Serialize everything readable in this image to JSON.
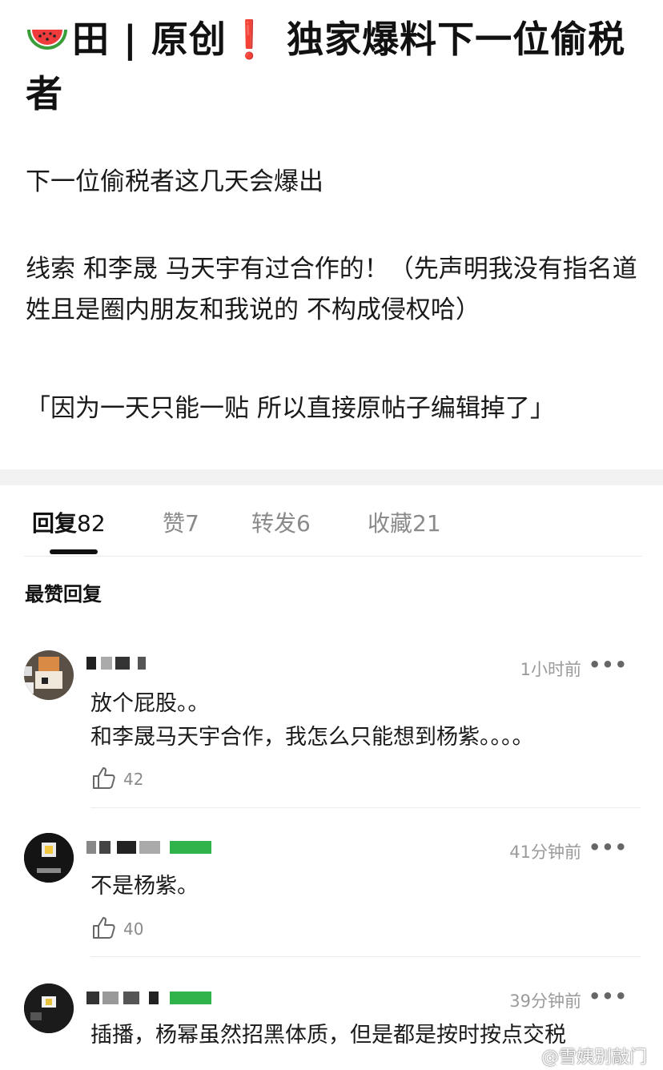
{
  "post": {
    "title": "田 | 原创",
    "title_exclaim": "❗",
    "title_rest": " 独家爆料下一位偷税者",
    "line1": "下一位偷税者这几天会爆出",
    "line2": "线索 和李晟 马天宇有过合作的！（先声明我没有指名道姓且是圈内朋友和我说的 不构成侵权哈）",
    "line3": "「因为一天只能一贴 所以直接原帖子编辑掉了」"
  },
  "tabs": [
    {
      "label": "回复",
      "count": "82"
    },
    {
      "label": "赞",
      "count": "7"
    },
    {
      "label": "转发",
      "count": "6"
    },
    {
      "label": "收藏",
      "count": "21"
    }
  ],
  "section_title": "最赞回复",
  "comments": [
    {
      "time": "1小时前",
      "text": "放个屁股。。\n和李晟马天宇合作，我怎么只能想到杨紫。。。。",
      "likes": "42",
      "more": "•••"
    },
    {
      "time": "41分钟前",
      "text": "不是杨紫。",
      "likes": "40",
      "more": "•••"
    },
    {
      "time": "39分钟前",
      "text": "插播，杨幂虽然招黑体质，但是都是按时按点交税",
      "likes": "",
      "more": "•••"
    }
  ],
  "watermark": "@雪姨别敲门",
  "colors": {
    "accent": "#111111",
    "exclaim": "#e1222b",
    "muted": "#8a8a8a",
    "band": "#f2f2f2",
    "badge_green": "#2fb34a"
  },
  "icons": {
    "title_icon": "watermelon-icon",
    "like_icon": "thumbs-up-icon",
    "more_icon": "more-dots-icon"
  }
}
